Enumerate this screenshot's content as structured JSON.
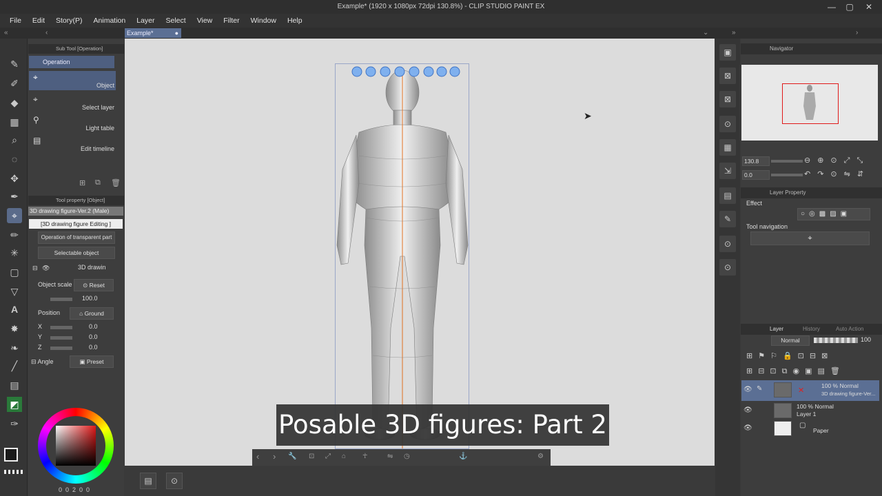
{
  "window": {
    "title": "Example* (1920 x 1080px 72dpi 130.8%) - CLIP STUDIO PAINT EX",
    "minimize": "—",
    "maximize": "▢",
    "close": "✕"
  },
  "menu": [
    "File",
    "Edit",
    "Story(P)",
    "Animation",
    "Layer",
    "Select",
    "View",
    "Filter",
    "Window",
    "Help"
  ],
  "document_tab": {
    "label": "Example*"
  },
  "sub_tool": {
    "header": "Sub Tool [Operation]",
    "group": "Operation",
    "items": [
      "Object",
      "Select layer",
      "Light table",
      "Edit timeline"
    ]
  },
  "tool_property": {
    "header": "Tool property [Object]",
    "object_name": "3D drawing figure-Ver.2 (Male)",
    "editing_label": "[3D drawing figure Editing ]",
    "transparent_op": "Operation of transparent part",
    "selectable": "Selectable object",
    "layer_entry": "3D drawin",
    "object_scale_label": "Object scale",
    "reset_label": "Reset",
    "scale_value": "100.0",
    "position_label": "Position",
    "ground_label": "Ground",
    "x_label": "X",
    "x_value": "0.0",
    "y_label": "Y",
    "y_value": "0.0",
    "z_label": "Z",
    "z_value": "0.0",
    "angle_label": "Angle",
    "preset_label": "Preset"
  },
  "color": {
    "main": "#1a1a1a",
    "sub": "#ffffff",
    "picker_hue": "#e01818",
    "footer": "0  0  2  0  0"
  },
  "caption": "Posable 3D figures: Part 2",
  "navigator": {
    "header": "Navigator",
    "zoom": "130.8",
    "rotation": "0.0"
  },
  "layer_property": {
    "header": "Layer Property",
    "effect_label": "Effect",
    "tool_nav_label": "Tool navigation"
  },
  "layers_panel": {
    "tabs": [
      "Layer",
      "History",
      "Auto Action"
    ],
    "blend_mode": "Normal",
    "opacity": "100",
    "layers": [
      {
        "line1": "100 % Normal",
        "line2": "3D drawing figure-Ver..."
      },
      {
        "line1": "100 % Normal",
        "line2": "Layer 1"
      },
      {
        "line1": "",
        "line2": "Paper"
      }
    ]
  },
  "accent_color": "#5a6b8a"
}
